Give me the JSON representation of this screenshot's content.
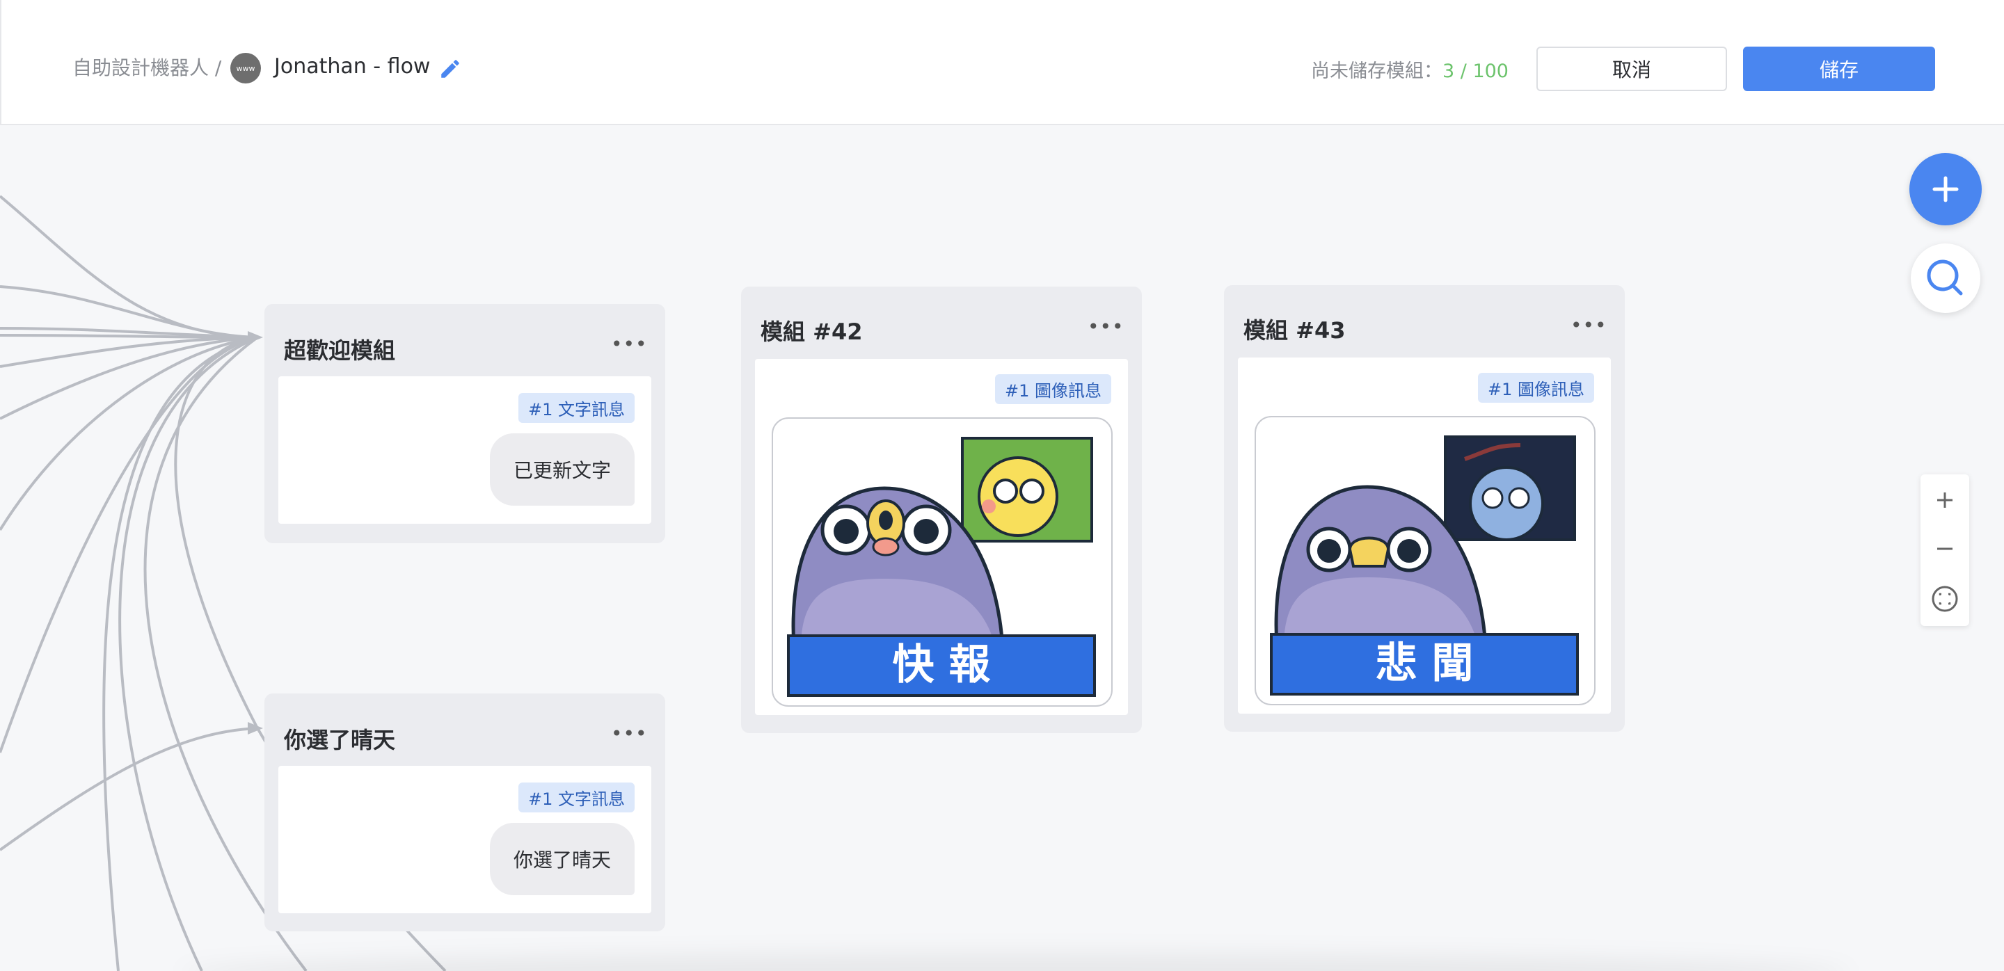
{
  "header": {
    "breadcrumb": "自助設計機器人 /",
    "avatar_text": "www",
    "flow_name": "Jonathan - flow",
    "edit_icon": "pencil-icon",
    "unsaved_label": "尚未儲存模組：",
    "unsaved_count": "3 / 100",
    "cancel_label": "取消",
    "save_label": "儲存"
  },
  "colors": {
    "accent": "#4a86f0",
    "count_green": "#6cc36c",
    "tag_bg": "#dce8fb",
    "tag_text": "#2d5fb8"
  },
  "nodes": [
    {
      "title": "超歡迎模組",
      "tag": "#1 文字訊息",
      "bubble": "已更新文字"
    },
    {
      "title": "你選了晴天",
      "tag": "#1 文字訊息",
      "bubble": "你選了晴天"
    },
    {
      "title": "模組 #42",
      "tag": "#1 圖像訊息",
      "sticker_caption": "快 報"
    },
    {
      "title": "模組 #43",
      "tag": "#1 圖像訊息",
      "sticker_caption": "悲 聞"
    }
  ],
  "more_label": "•••",
  "tools": {
    "add_icon": "plus-icon",
    "search_icon": "search-icon",
    "zoom_in_icon": "zoom-in-icon",
    "zoom_out_icon": "zoom-out-icon",
    "fit_icon": "fit-view-icon"
  }
}
